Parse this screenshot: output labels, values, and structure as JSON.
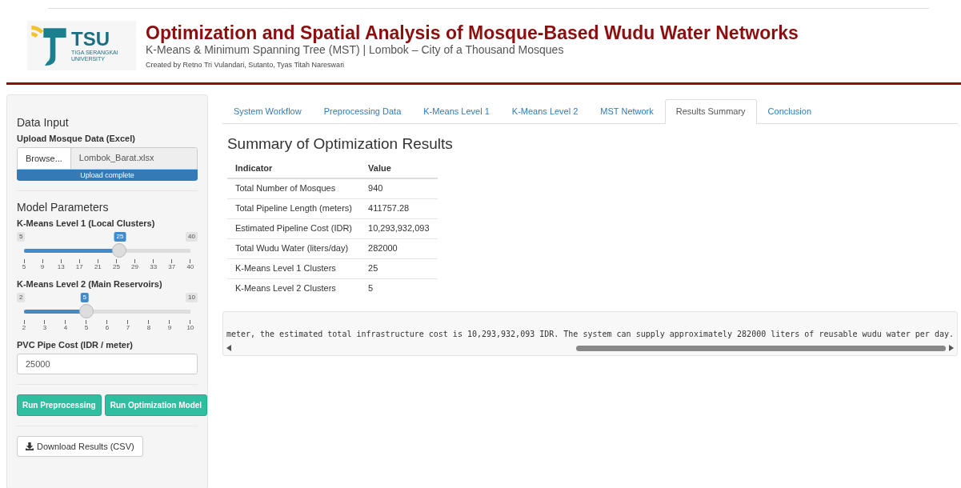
{
  "header": {
    "logo": {
      "abbr": "TSU",
      "line_1": "TIGA SERANGKAI",
      "line_2": "UNIVERSITY"
    },
    "title": "Optimization and Spatial Analysis of Mosque-Based Wudu Water Networks",
    "subtitle": "K-Means & Minimum Spanning Tree (MST) | Lombok – City of a Thousand Mosques",
    "credits": "Created by Retno Tri Vulandari, Sutanto, Tyas Titah Nareswari"
  },
  "sidebar": {
    "data_input": {
      "heading": "Data Input",
      "label": "Upload Mosque Data (Excel)",
      "browse": "Browse...",
      "file": "Lombok_Barat.xlsx",
      "progress": {
        "text": "Upload complete",
        "level": 1
      }
    },
    "model_parameters": {
      "heading": "Model Parameters",
      "sliders": [
        {
          "label": "K-Means Level 1 (Local Clusters)",
          "min": "5",
          "max": "40",
          "value": "25",
          "level": 0.571,
          "ticks": [
            "5",
            "9",
            "13",
            "17",
            "21",
            "25",
            "29",
            "33",
            "37",
            "40"
          ]
        },
        {
          "label": "K-Means Level 2 (Main Reservoirs)",
          "min": "2",
          "max": "10",
          "value": "5",
          "level": 0.375,
          "ticks": [
            "2",
            "3",
            "4",
            "5",
            "6",
            "7",
            "8",
            "9",
            "10"
          ]
        }
      ],
      "pipe_cost": {
        "label": "PVC Pipe Cost (IDR / meter)",
        "value": "25000"
      }
    },
    "buttons": [
      "Run Preprocessing",
      "Run Optimization Model"
    ],
    "download": "Download Results (CSV)"
  },
  "tabs": [
    {
      "label": "System Workflow",
      "selected": false
    },
    {
      "label": "Preprocessing Data",
      "selected": false
    },
    {
      "label": "K-Means Level 1",
      "selected": false
    },
    {
      "label": "K-Means Level 2",
      "selected": false
    },
    {
      "label": "MST Network",
      "selected": false
    },
    {
      "label": "Results Summary",
      "selected": true
    },
    {
      "label": "Conclusion",
      "selected": false
    }
  ],
  "summary": {
    "heading": "Summary of Optimization Results",
    "table": {
      "columns": [
        "Indicator",
        "Value"
      ],
      "rows": [
        [
          "Total Number of Mosques",
          "940"
        ],
        [
          "Total Pipeline Length (meters)",
          "411757.28"
        ],
        [
          "Estimated Pipeline Cost (IDR)",
          "10,293,932,093"
        ],
        [
          "Total Wudu Water (liters/day)",
          "282000"
        ],
        [
          "K-Means Level 1 Clusters",
          "25"
        ],
        [
          "K-Means Level 2 Clusters",
          "5"
        ]
      ]
    },
    "output_text": "meter, the estimated total infrastructure cost is 10,293,932,093 IDR. The system can supply approximately 282000 liters of reusable wudu water per day."
  }
}
